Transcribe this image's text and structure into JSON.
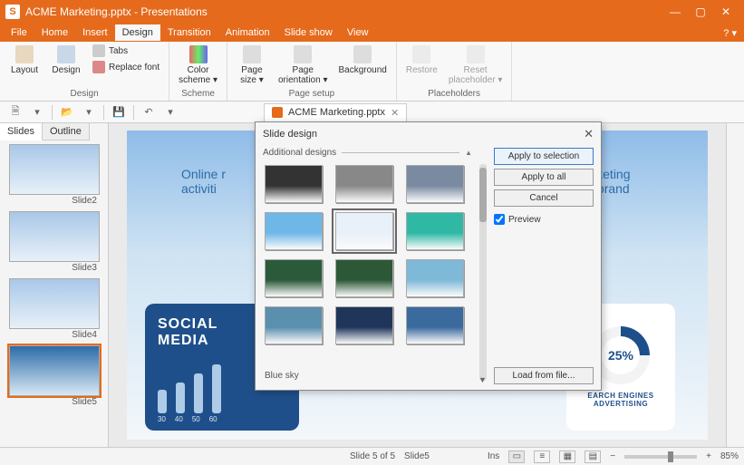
{
  "title": "ACME Marketing.pptx - Presentations",
  "menubar": [
    "File",
    "Home",
    "Insert",
    "Design",
    "Transition",
    "Animation",
    "Slide show",
    "View"
  ],
  "menubar_active": 3,
  "ribbon": {
    "groups": {
      "design": {
        "label": "Design",
        "layout": "Layout",
        "design_btn": "Design",
        "tabs": "Tabs",
        "replace_font": "Replace font"
      },
      "scheme": {
        "label": "Scheme",
        "color_scheme": "Color\nscheme ▾"
      },
      "page_setup": {
        "label": "Page setup",
        "page_size": "Page\nsize ▾",
        "page_orientation": "Page\norientation ▾",
        "background": "Background"
      },
      "placeholders": {
        "label": "Placeholders",
        "restore": "Restore",
        "reset_placeholder": "Reset\nplaceholder ▾"
      }
    }
  },
  "doc_tab": "ACME Marketing.pptx",
  "side_tabs": {
    "slides": "Slides",
    "outline": "Outline"
  },
  "thumbs": [
    "Slide2",
    "Slide3",
    "Slide4",
    "Slide5"
  ],
  "slide": {
    "title_fragment_left": "Online r",
    "title_fragment_right": "l marketing",
    "subtitle_left": "activiti",
    "subtitle_right": "rom brand",
    "social_card_title": "SOCIAL\nMEDIA",
    "social_bars": [
      "30",
      "40",
      "50",
      "60"
    ],
    "search_pct": "25%",
    "search_label_top": "EARCH ENGINES",
    "search_label_bottom": "ADVERTISING"
  },
  "dialog": {
    "title": "Slide design",
    "additional": "Additional designs",
    "apply_sel": "Apply to selection",
    "apply_all": "Apply to all",
    "cancel": "Cancel",
    "preview": "Preview",
    "load_file": "Load from file...",
    "selected_name": "Blue sky",
    "design_colors": [
      "#333333",
      "#888888",
      "#7a8aa0",
      "#6fb7e6",
      "#e8f0f9",
      "#2fb9a5",
      "#2b5a3a",
      "#2d5838",
      "#7fb9d8",
      "#5a8fae",
      "#1f365a",
      "#3b6a9e"
    ],
    "selected_index": 4
  },
  "status": {
    "pages": "Slide 5 of 5",
    "slide_label": "Slide5",
    "ins": "Ins",
    "zoom": "85%"
  },
  "chart_data": {
    "type": "bar",
    "title": "SOCIAL MEDIA",
    "categories": [
      "30",
      "40",
      "50",
      "60"
    ],
    "values": [
      30,
      40,
      50,
      60
    ],
    "donut": {
      "label": "SEARCH ENGINES ADVERTISING",
      "value_pct": 25
    }
  }
}
